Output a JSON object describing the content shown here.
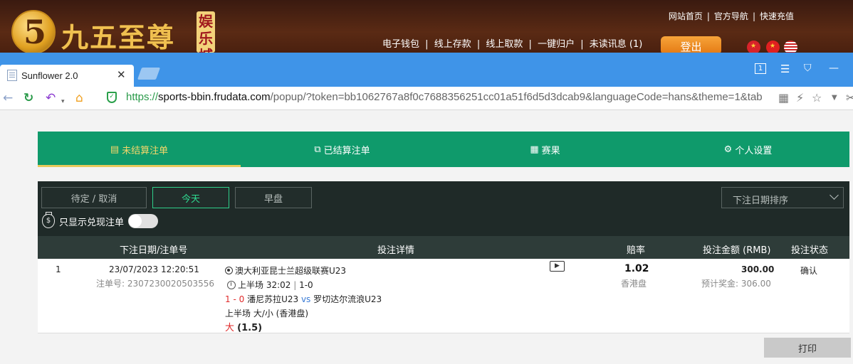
{
  "site": {
    "logo_digit": "5",
    "logo_text": "九五至尊",
    "logo_tag": "娱乐城",
    "top_links": [
      "网站首页",
      "|",
      "官方导航",
      "|",
      "快速充值"
    ],
    "main_links": [
      "电子钱包",
      "|",
      "线上存款",
      "|",
      "线上取款",
      "|",
      "一键归户",
      "|",
      "未读讯息 (1)"
    ],
    "login_label": "登出"
  },
  "browser": {
    "tab_title": "Sunflower 2.0",
    "tab_close": "✕",
    "url_scheme": "https://",
    "url_host": "sports-bbin.frudata.com",
    "url_path": "/popup/?token=bb1062767a8f0c7688356251cc01a51f6d5d3dcab9&languageCode=hans&theme=1&tab",
    "tab_count": "1"
  },
  "main_tabs": [
    {
      "label": "未结算注单",
      "icon": "receipt-icon",
      "glyph": "▤"
    },
    {
      "label": "已结算注单",
      "icon": "settled-icon",
      "glyph": "⧉"
    },
    {
      "label": "赛果",
      "icon": "results-icon",
      "glyph": "▦"
    },
    {
      "label": "个人设置",
      "icon": "gear-icon",
      "glyph": "⚙"
    }
  ],
  "filters": {
    "pending_label": "待定 / 取消",
    "today_label": "今天",
    "early_label": "早盘",
    "sort_label": "下注日期排序",
    "cashout_label": "只显示兑现注单"
  },
  "table": {
    "headers": {
      "date": "下注日期/注单号",
      "detail": "投注详情",
      "odds": "赔率",
      "amount": "投注金额 (RMB)",
      "status": "投注状态"
    },
    "rows": [
      {
        "index": "1",
        "datetime": "23/07/2023 12:20:51",
        "bet_no": "注单号: 2307230020503556",
        "league": "澳大利亚昆士兰超级联赛U23",
        "period": "上半场 32:02",
        "period_score": "1-0",
        "score": "1 - 0",
        "home": "潘尼苏拉U23",
        "vs": "vs",
        "away": "罗切达尔流浪U23",
        "market": "上半场 大/小 (香港盘)",
        "pick": "大",
        "line": "(1.5)",
        "odds": "1.02",
        "odds_type": "香港盘",
        "stake": "300.00",
        "payout": "预计奖金: 306.00",
        "status": "确认"
      }
    ]
  },
  "print_label": "打印"
}
